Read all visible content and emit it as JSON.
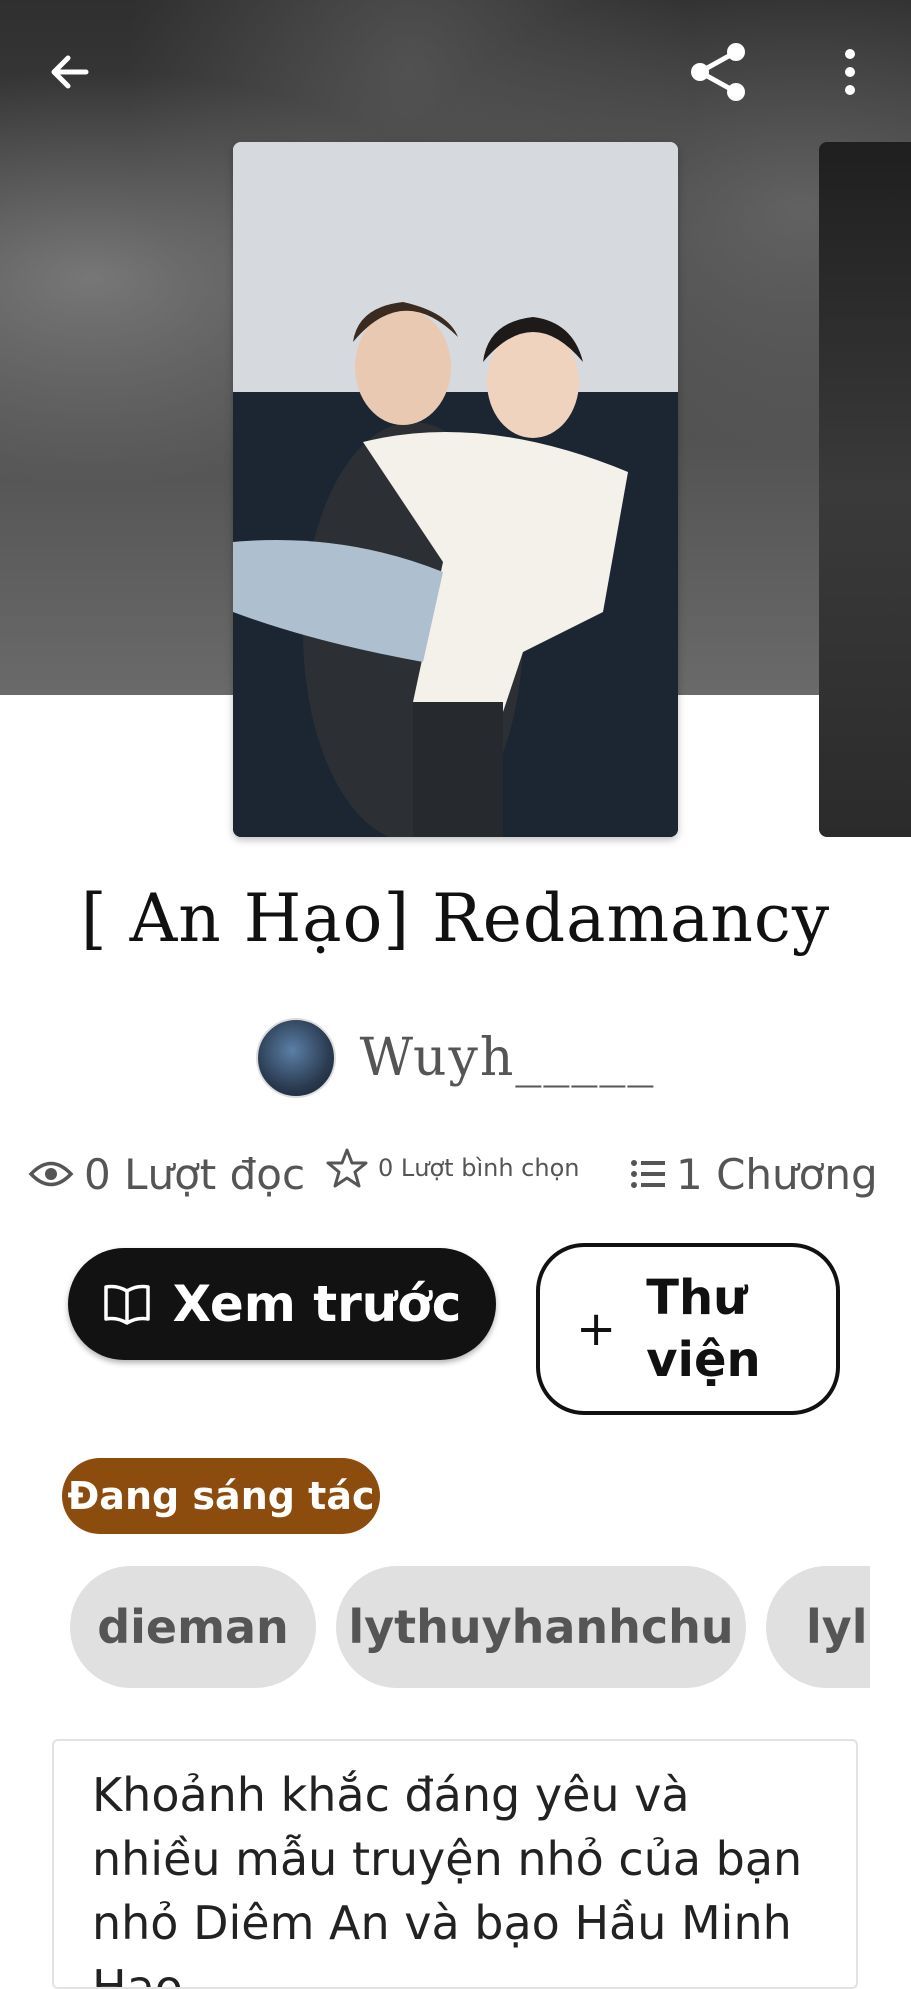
{
  "story": {
    "title": "[ An Hạo] Redamancy",
    "author": "Wuyh_____",
    "status": "Đang sáng tác",
    "description": "Khoảnh khắc đáng yêu và nhiều mẫu truyện nhỏ của bạn nhỏ Diêm An và bạo Hầu Minh Hạo"
  },
  "stats": {
    "reads": "0 Lượt đọc",
    "votes": "0 Lượt bình chọn",
    "chapters": "1 Chương"
  },
  "actions": {
    "preview_label": "Xem trước",
    "library_label": "Thư viện"
  },
  "tags": [
    "dieman",
    "lythuyhanhchu",
    "lylu"
  ],
  "icons": {
    "back": "arrow-left-icon",
    "share": "share-icon",
    "more": "more-vertical-icon",
    "reads": "eye-icon",
    "votes": "star-icon",
    "chapters": "list-icon",
    "preview": "book-icon",
    "library": "plus-icon"
  },
  "colors": {
    "status_badge": "#8b4c0d",
    "primary_button": "#121212",
    "tag_bg": "#e0e0e0"
  }
}
